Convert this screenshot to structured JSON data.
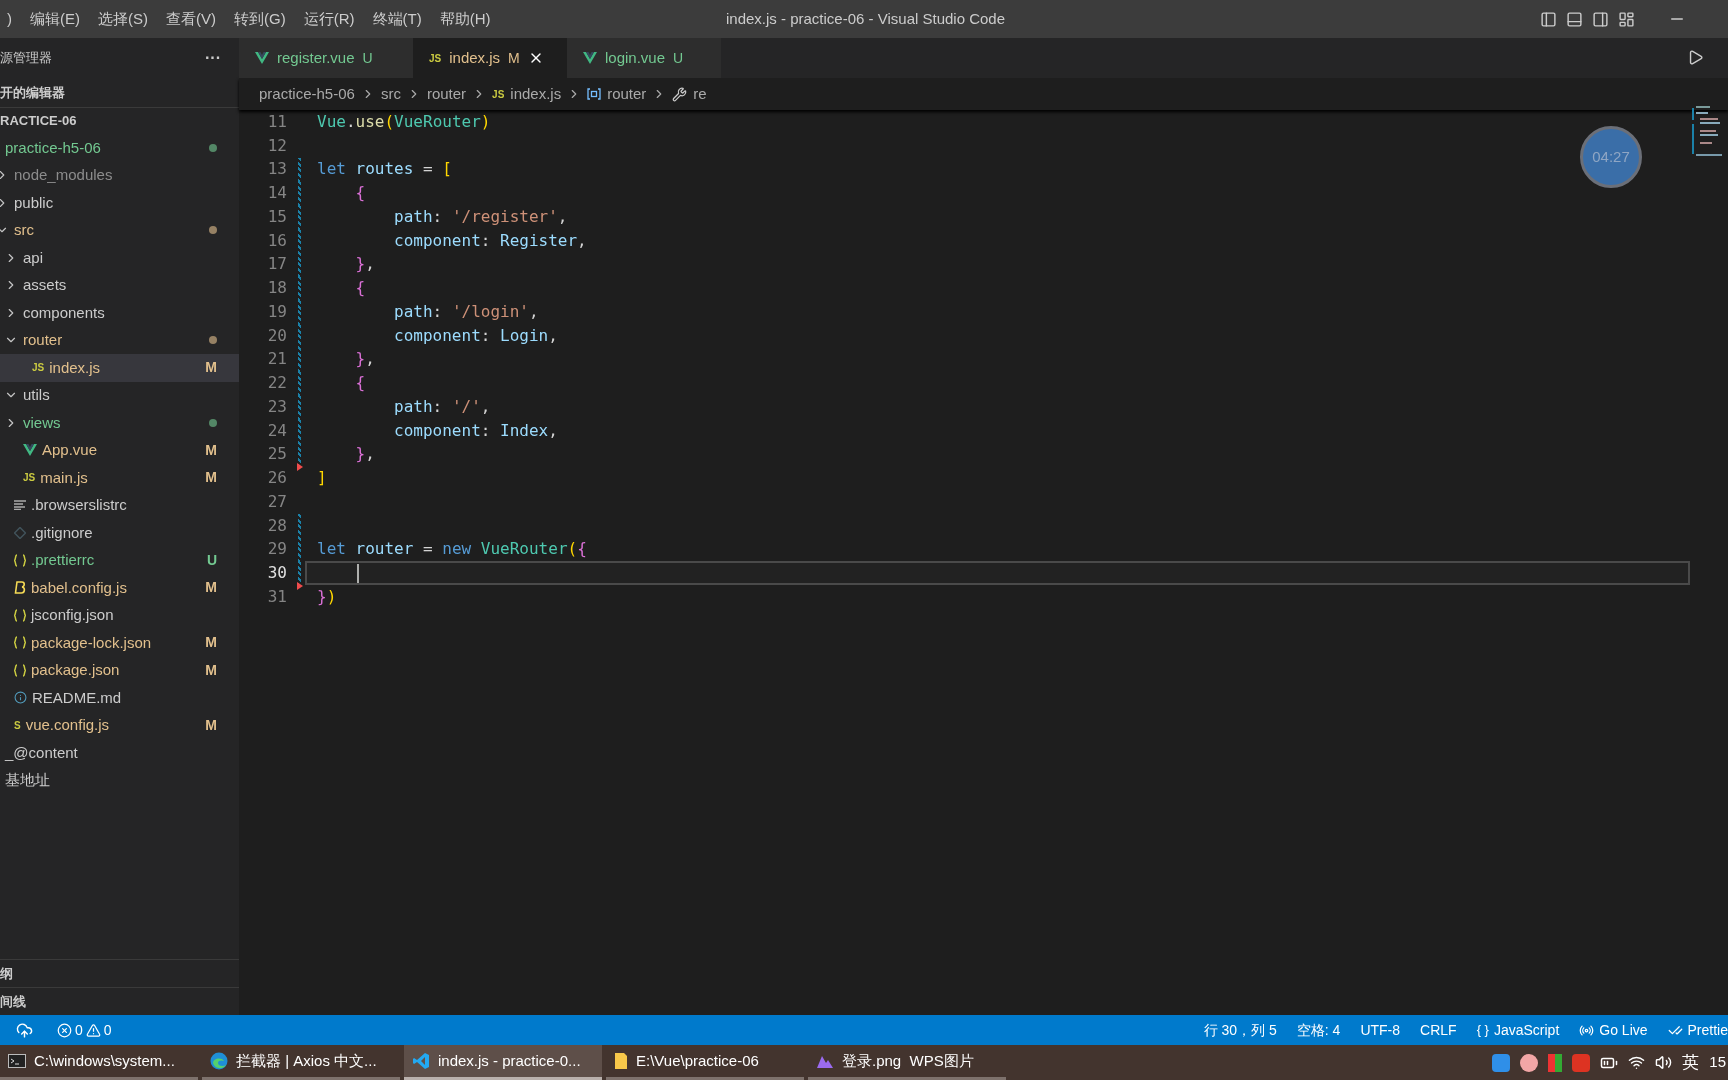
{
  "title_bar": {
    "menu": [
      ")",
      "编辑(E)",
      "选择(S)",
      "查看(V)",
      "转到(G)",
      "运行(R)",
      "终端(T)",
      "帮助(H)"
    ],
    "title": "index.js - practice-06 - Visual Studio Code"
  },
  "sidebar": {
    "title": "源管理器",
    "more": "···",
    "open_editors": "开的编辑器",
    "workspace": "RACTICE-06",
    "tree": [
      {
        "name": "practice-h5-06",
        "color": "#73c991",
        "dot": true,
        "selected": false,
        "children": [
          {
            "name": "node_modules",
            "kind": "folder",
            "color": "#8c8c8c",
            "expanded": false,
            "dot": false,
            "selected": false
          },
          {
            "name": "public",
            "kind": "folder",
            "color": "#cccccc",
            "expanded": false,
            "dot": false,
            "selected": false
          },
          {
            "name": "src",
            "kind": "folder",
            "color": "#e2c08d",
            "expanded": true,
            "dot": true,
            "selected": false,
            "children": [
              {
                "name": "api",
                "kind": "folder",
                "color": "#cccccc",
                "expanded": false,
                "dot": false,
                "selected": false
              },
              {
                "name": "assets",
                "kind": "folder",
                "color": "#cccccc",
                "expanded": false,
                "dot": false,
                "selected": false
              },
              {
                "name": "components",
                "kind": "folder",
                "color": "#cccccc",
                "expanded": false,
                "dot": false,
                "selected": false
              },
              {
                "name": "router",
                "kind": "folder",
                "color": "#e2c08d",
                "expanded": true,
                "dot": true,
                "selected": false,
                "children": [
                  {
                    "name": "index.js",
                    "kind": "js",
                    "icon_text": "JS",
                    "color": "#e2c08d",
                    "badge": "M",
                    "dot": false,
                    "selected": true
                  }
                ]
              },
              {
                "name": "utils",
                "kind": "folder",
                "color": "#cccccc",
                "expanded": true,
                "dot": false,
                "selected": false
              },
              {
                "name": "views",
                "kind": "folder",
                "color": "#73c991",
                "expanded": false,
                "dot": true,
                "selected": false
              },
              {
                "name": "App.vue",
                "kind": "vue",
                "color": "#e2c08d",
                "badge": "M",
                "dot": false,
                "selected": false
              },
              {
                "name": "main.js",
                "kind": "js",
                "icon_text": "JS",
                "color": "#e2c08d",
                "badge": "M",
                "dot": false,
                "selected": false
              }
            ]
          },
          {
            "name": ".browserslistrc",
            "kind": "lines",
            "color": "#cccccc",
            "dot": false,
            "selected": false
          },
          {
            "name": ".gitignore",
            "kind": "diamond",
            "color": "#cccccc",
            "dot": false,
            "selected": false
          },
          {
            "name": ".prettierrc",
            "kind": "braces",
            "color": "#73c991",
            "badge": "U",
            "dot": false,
            "selected": false
          },
          {
            "name": "babel.config.js",
            "kind": "babel",
            "color": "#e2c08d",
            "badge": "M",
            "dot": false,
            "selected": false
          },
          {
            "name": "jsconfig.json",
            "kind": "braces",
            "color": "#cccccc",
            "dot": false,
            "selected": false
          },
          {
            "name": "package-lock.json",
            "kind": "braces",
            "color": "#e2c08d",
            "badge": "M",
            "dot": false,
            "selected": false
          },
          {
            "name": "package.json",
            "kind": "braces",
            "color": "#e2c08d",
            "badge": "M",
            "dot": false,
            "selected": false
          },
          {
            "name": "README.md",
            "kind": "info",
            "color": "#cccccc",
            "dot": false,
            "selected": false
          },
          {
            "name": "vue.config.js",
            "kind": "js",
            "icon_text": "S",
            "color": "#e2c08d",
            "badge": "M",
            "dot": false,
            "selected": false
          }
        ]
      },
      {
        "name": "_@content",
        "color": "#cccccc",
        "dot": false,
        "selected": false
      },
      {
        "name": "基地址",
        "color": "#cccccc",
        "dot": false,
        "selected": false
      }
    ],
    "outline": "纲",
    "timeline": "间线"
  },
  "tabs": [
    {
      "label": "register.vue",
      "kind": "vue",
      "badge": "U",
      "color": "#73c991",
      "selected": false
    },
    {
      "label": "index.js",
      "kind": "js",
      "icon_text": "JS",
      "badge": "M",
      "color": "#e2c08d",
      "selected": true
    },
    {
      "label": "login.vue",
      "kind": "vue",
      "badge": "U",
      "color": "#73c991",
      "selected": false
    }
  ],
  "breadcrumb": [
    {
      "label": "practice-h5-06",
      "kind": "folder"
    },
    {
      "label": "src",
      "kind": "folder"
    },
    {
      "label": "router",
      "kind": "folder"
    },
    {
      "label": "index.js",
      "kind": "js",
      "icon_text": "JS"
    },
    {
      "label": "router",
      "kind": "symbol"
    },
    {
      "label": "re",
      "kind": "wrench"
    }
  ],
  "timer": "04:27",
  "code": [
    {
      "number": "11",
      "kind": "plain",
      "current": false,
      "text": "Vue.use(VueRouter)"
    },
    {
      "number": "12",
      "kind": "plain",
      "current": false
    },
    {
      "number": "13",
      "kind": "modified",
      "current": false,
      "text": "let routes = ["
    },
    {
      "number": "14",
      "kind": "modified",
      "current": false,
      "text": "    {"
    },
    {
      "number": "15",
      "kind": "modified",
      "current": false,
      "text": "        path: '/register',"
    },
    {
      "number": "16",
      "kind": "modified",
      "current": false,
      "text": "        component: Register,"
    },
    {
      "number": "17",
      "kind": "modified",
      "current": false,
      "text": "    },"
    },
    {
      "number": "18",
      "kind": "modified",
      "current": false,
      "text": "    {"
    },
    {
      "number": "19",
      "kind": "modified",
      "current": false,
      "text": "        path: '/login',"
    },
    {
      "number": "20",
      "kind": "modified",
      "current": false,
      "text": "        component: Login,"
    },
    {
      "number": "21",
      "kind": "modified",
      "current": false,
      "text": "    },"
    },
    {
      "number": "22",
      "kind": "modified",
      "current": false,
      "text": "    {"
    },
    {
      "number": "23",
      "kind": "modified",
      "current": false,
      "text": "        path: '/',"
    },
    {
      "number": "24",
      "kind": "modified",
      "current": false,
      "text": "        component: Index,"
    },
    {
      "number": "25",
      "kind": "modified",
      "current": false,
      "text": "    },"
    },
    {
      "number": "26",
      "kind": "deleted",
      "current": false,
      "text": "]"
    },
    {
      "number": "27",
      "kind": "plain",
      "current": false
    },
    {
      "number": "28",
      "kind": "modified",
      "current": false
    },
    {
      "number": "29",
      "kind": "modified",
      "current": false,
      "text": "let router = new VueRouter({"
    },
    {
      "number": "30",
      "kind": "modified",
      "current": true
    },
    {
      "number": "31",
      "kind": "deleted",
      "current": false,
      "text": "})"
    }
  ],
  "status_bar": {
    "errors": "0",
    "warnings": "0",
    "right": [
      {
        "label": "行 30，列 5",
        "kind": "plain"
      },
      {
        "label": "空格: 4",
        "kind": "plain"
      },
      {
        "label": "UTF-8",
        "kind": "plain"
      },
      {
        "label": "CRLF",
        "kind": "plain"
      },
      {
        "label": "JavaScript",
        "kind": "braces",
        "icon_text": "{ }"
      },
      {
        "label": "Go Live",
        "kind": "broadcast"
      },
      {
        "label": "Prettie",
        "kind": "checks"
      }
    ]
  },
  "taskbar": {
    "items": [
      {
        "label": "C:\\windows\\system...",
        "kind": "console",
        "selected": false
      },
      {
        "label": "拦截器 | Axios 中文...",
        "kind": "browser",
        "selected": false
      },
      {
        "label": "index.js - practice-0...",
        "kind": "editor",
        "selected": true
      },
      {
        "label": "E:\\Vue\\practice-06",
        "kind": "folder",
        "selected": false
      },
      {
        "label": "登录.png  WPS图片",
        "kind": "image",
        "selected": false
      }
    ],
    "ime": "英",
    "clock": "15"
  }
}
